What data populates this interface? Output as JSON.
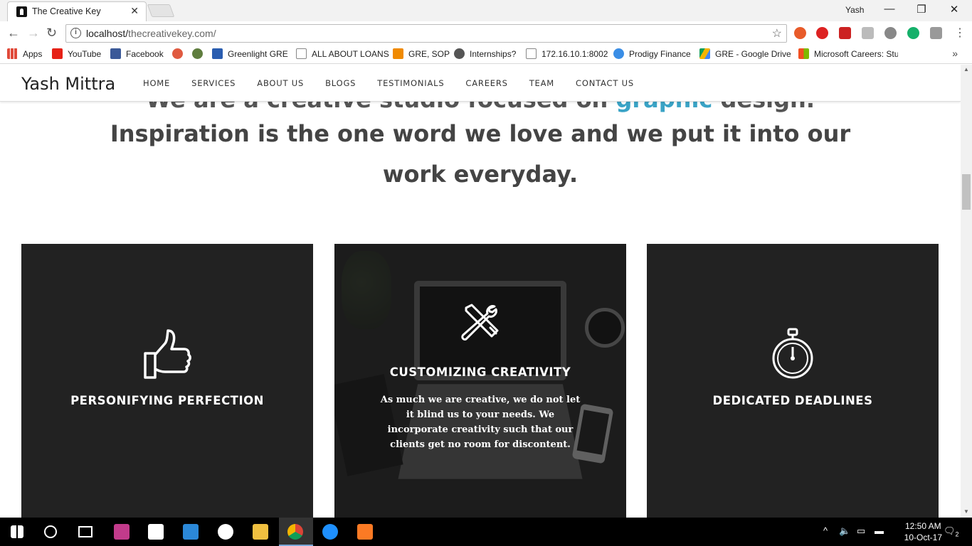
{
  "browser": {
    "tab_title": "The Creative Key",
    "user_name": "Yash",
    "url_host": "localhost/",
    "url_path": "thecreativekey.com/",
    "bookmarks": [
      {
        "label": "Apps",
        "color": "#e04a3a"
      },
      {
        "label": "YouTube",
        "color": "#e62117"
      },
      {
        "label": "Facebook",
        "color": "#3b5998"
      },
      {
        "label": "",
        "color": "#e05a40"
      },
      {
        "label": "",
        "color": "#5f7d3e"
      },
      {
        "label": "Greenlight GRE",
        "color": "#2a5db0"
      },
      {
        "label": "ALL ABOUT LOANS",
        "color": "#888888"
      },
      {
        "label": "GRE, SOP",
        "color": "#f08a00"
      },
      {
        "label": "Internships?",
        "color": "#555555"
      },
      {
        "label": "172.16.10.1:8002",
        "color": "#888888"
      },
      {
        "label": "Prodigy Finance",
        "color": "#3a8ee6"
      },
      {
        "label": "GRE - Google Drive",
        "color": "#f4b400"
      },
      {
        "label": "Microsoft Careers: Stu",
        "color": "#f25022"
      }
    ]
  },
  "site": {
    "brand": "Yash Mittra",
    "nav": [
      "HOME",
      "SERVICES",
      "ABOUT US",
      "BLOGS",
      "TESTIMONIALS",
      "CAREERS",
      "TEAM",
      "CONTACT US"
    ],
    "hero_hidden_before": "We are a creative studio focused on ",
    "hero_hidden_accent": "graphic",
    "hero_hidden_after": " design.",
    "hero_line1": "Inspiration is the one word we love and we put it into our",
    "hero_line2": "work everyday.",
    "cards": [
      {
        "title": "PERSONIFYING PERFECTION",
        "icon": "thumbs-up-icon"
      },
      {
        "title": "CUSTOMIZING CREATIVITY",
        "icon": "tools-icon",
        "description": "As much we are creative, we do not let it blind us to your needs. We incorporate creativity such that our clients get no room for discontent."
      },
      {
        "title": "DEDICATED DEADLINES",
        "icon": "stopwatch-icon"
      }
    ]
  },
  "taskbar": {
    "time": "12:50 AM",
    "date": "10-Oct-17",
    "notifications": "2"
  }
}
